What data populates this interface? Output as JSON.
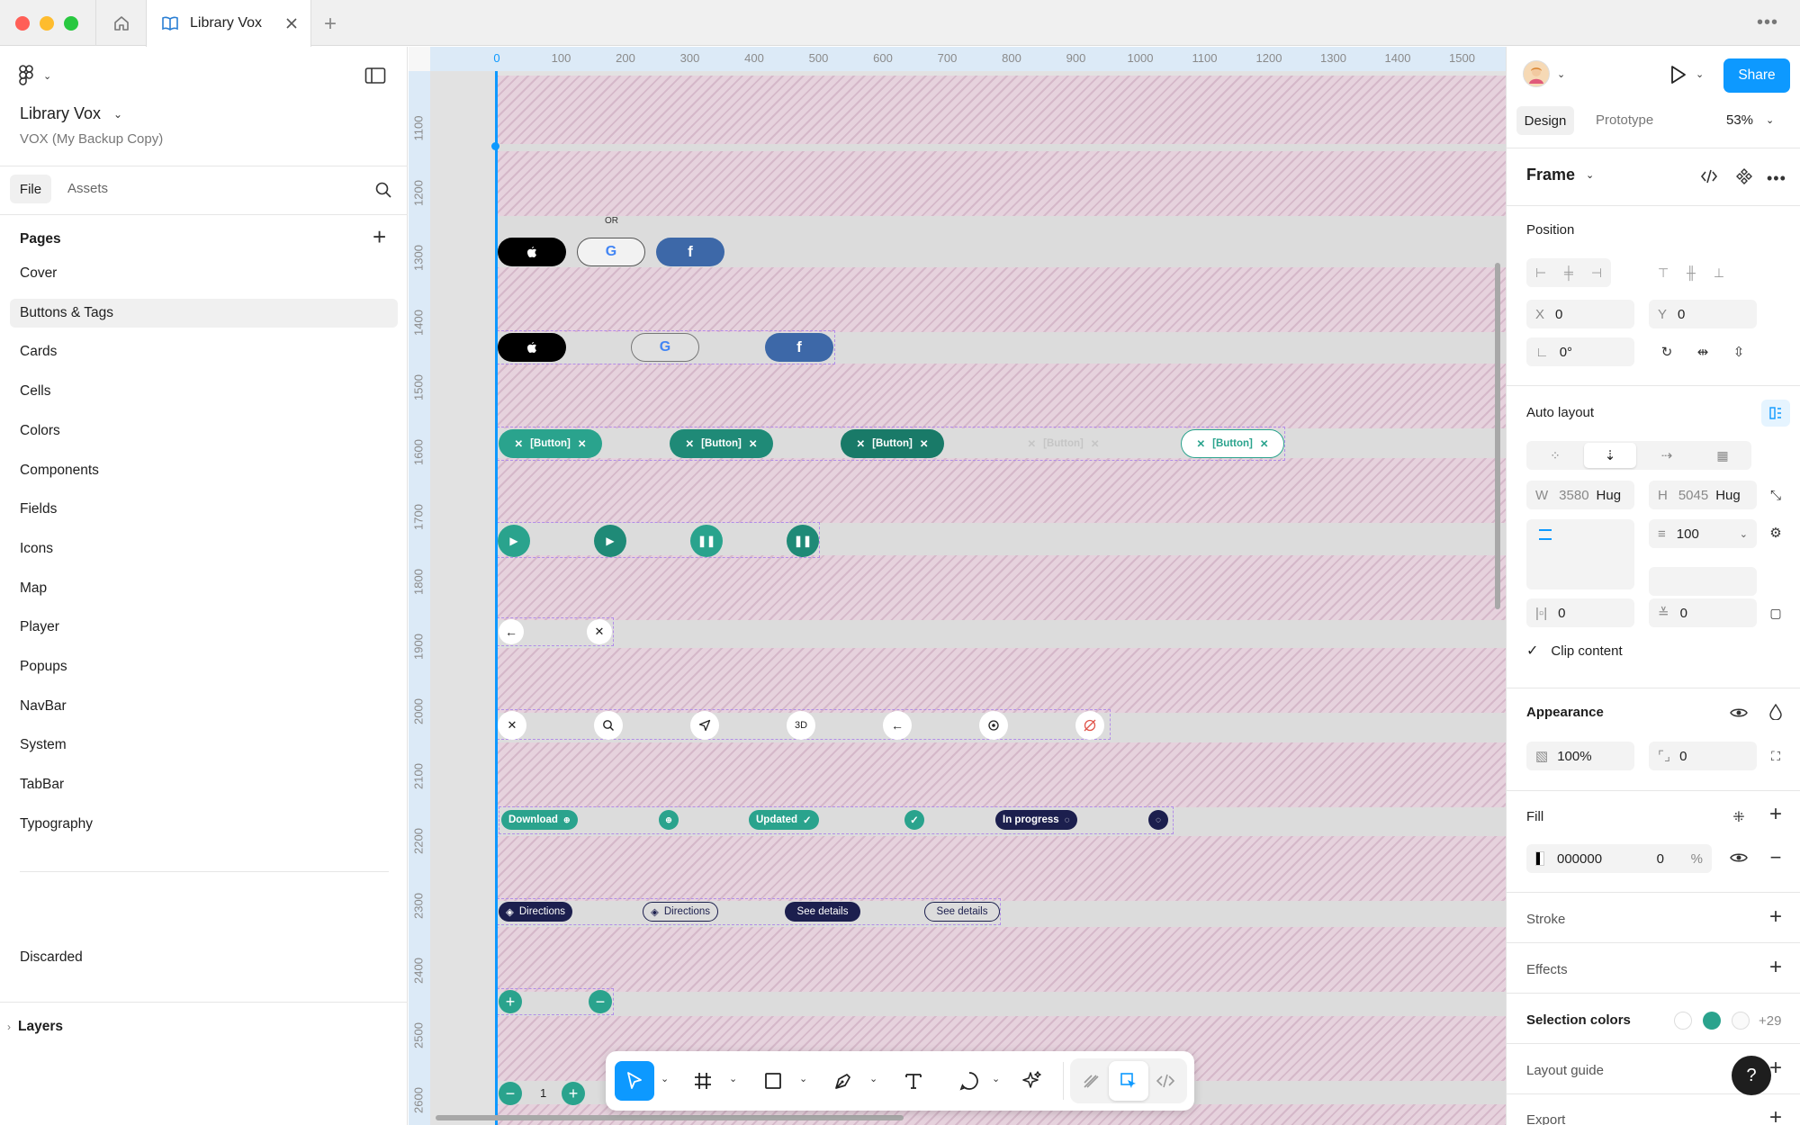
{
  "tab": {
    "title": "Library Vox"
  },
  "file": {
    "name": "Library Vox",
    "subtitle": "VOX (My Backup Copy)"
  },
  "left_tabs": {
    "file": "File",
    "assets": "Assets"
  },
  "pages": {
    "heading": "Pages",
    "items": [
      "Cover",
      "Buttons & Tags",
      "Cards",
      "Cells",
      "Colors",
      "Components",
      "Fields",
      "Icons",
      "Map",
      "Player",
      "Popups",
      "NavBar",
      "System",
      "TabBar",
      "Typography"
    ],
    "selected": "Buttons & Tags",
    "discarded": "Discarded"
  },
  "layers": {
    "label": "Layers"
  },
  "ruler": {
    "top": [
      "0",
      "100",
      "200",
      "300",
      "400",
      "500",
      "600",
      "700",
      "800",
      "900",
      "1000",
      "1100",
      "1200",
      "1300",
      "1400",
      "1500"
    ],
    "left": [
      "1100",
      "1200",
      "1300",
      "1400",
      "1500",
      "1600",
      "1700",
      "1800",
      "1900",
      "2000",
      "2100",
      "2200",
      "2300",
      "2400",
      "2500",
      "2600"
    ]
  },
  "canvas": {
    "or_label": "OR",
    "social": {
      "apple": "",
      "google": "G",
      "facebook": "f"
    },
    "chip_label": "[Button]",
    "icon_3d": "3D",
    "tags": {
      "download": "Download",
      "updated": "Updated",
      "in_progress": "In progress"
    },
    "action_tags": {
      "directions": "Directions",
      "see_details": "See details"
    },
    "stepper_value": "1"
  },
  "right": {
    "tabs": {
      "design": "Design",
      "prototype": "Prototype"
    },
    "zoom": "53%",
    "share": "Share",
    "selection_type": "Frame",
    "position": {
      "heading": "Position",
      "x_label": "X",
      "x": "0",
      "y_label": "Y",
      "y": "0",
      "rotation": "0°"
    },
    "auto_layout": {
      "heading": "Auto layout",
      "w_label": "W",
      "w": "3580",
      "w_mode": "Hug",
      "h_label": "H",
      "h": "5045",
      "h_mode": "Hug",
      "gap": "100",
      "pad_h": "0",
      "pad_v": "0",
      "clip_label": "Clip content"
    },
    "appearance": {
      "heading": "Appearance",
      "opacity": "100%",
      "radius": "0"
    },
    "fill": {
      "heading": "Fill",
      "hex": "000000",
      "opacity": "0",
      "pct": "%"
    },
    "stroke": {
      "heading": "Stroke"
    },
    "effects": {
      "heading": "Effects"
    },
    "selection_colors": {
      "heading": "Selection colors",
      "more": "+29"
    },
    "layout_guide": {
      "heading": "Layout guide"
    },
    "export": {
      "heading": "Export"
    }
  },
  "help": {
    "label": "?"
  },
  "colors": {
    "accent": "#0d99ff",
    "teal": "#2aa38d",
    "navy": "#1c1f4e",
    "facebook": "#3d68a8"
  }
}
